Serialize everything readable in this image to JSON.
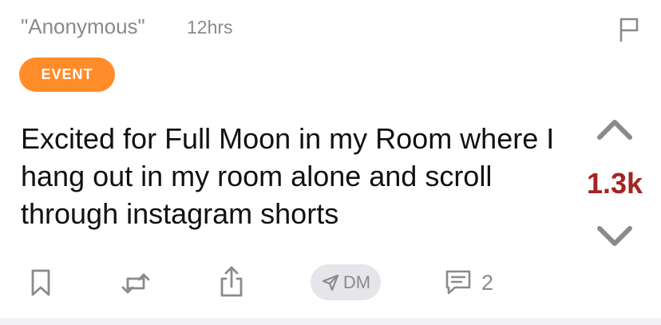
{
  "post": {
    "author": "\"Anonymous\"",
    "time": "12hrs",
    "tag": "EVENT",
    "text": "Excited for Full Moon in my Room where I hang out in my room alone and scroll through instagram shorts",
    "score": "1.3k"
  },
  "actions": {
    "dm_label": "DM",
    "comment_count": "2"
  },
  "icons": {
    "flag": "flag-icon",
    "upvote": "chevron-up-icon",
    "downvote": "chevron-down-icon",
    "bookmark": "bookmark-icon",
    "repost": "repost-icon",
    "share": "share-icon",
    "dm": "send-icon",
    "comment": "comment-icon"
  },
  "colors": {
    "tag_background": "#ff8c29",
    "score": "#a32424",
    "muted_text": "#8a8a8e",
    "dm_pill": "#e6e6ea"
  }
}
